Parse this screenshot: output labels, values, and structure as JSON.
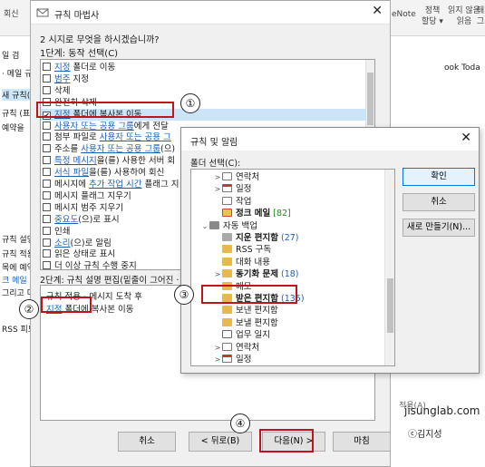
{
  "bg": {
    "ribbon_left": [
      "회신"
    ],
    "ribbon_right": {
      "onenote": "eNote",
      "policy": "정책\n할당 ▾",
      "unread": "읽지 않음\n읽음",
      "tag": "태그"
    },
    "left_panel": [
      "일 검",
      "· 메일 규",
      "새 규칙(",
      "규칙 (표",
      "예약을",
      "규칙 설명(",
      "규칙 적용",
      "목에 예약",
      "크 메일",
      "그리고 다",
      "RSS 피드"
    ],
    "right_panel": "ook Toda",
    "status_text": "적용(A)"
  },
  "wizard": {
    "title": "규칙 마법사",
    "question": "2  시지로 무엇을 하시겠습니까?",
    "step1_label": "1단계: 동작 선택(C)",
    "actions": [
      {
        "checked": false,
        "prefix": "",
        "link": "지정",
        "suffix": " 폴더로 이동"
      },
      {
        "checked": false,
        "prefix": "",
        "link": "범주",
        "suffix": " 지정"
      },
      {
        "checked": false,
        "prefix": "삭제",
        "link": "",
        "suffix": ""
      },
      {
        "checked": false,
        "prefix": "완전히 삭제",
        "link": "",
        "suffix": ""
      },
      {
        "checked": true,
        "prefix": "",
        "link": "지정",
        "suffix": " 폴더에 복사본 이동"
      },
      {
        "checked": false,
        "prefix": "",
        "link": "사용자 또는 공용 그룹",
        "suffix": "에게 전달"
      },
      {
        "checked": false,
        "prefix": "첨부 파일로 ",
        "link": "사용자 또는 공용 그",
        "suffix": ""
      },
      {
        "checked": false,
        "prefix": "주소를 ",
        "link": "사용자 또는 공용 그룹",
        "suffix": "(으)"
      },
      {
        "checked": false,
        "prefix": "",
        "link": "특정 메시지",
        "suffix": "을(를) 사용한 서버 회"
      },
      {
        "checked": false,
        "prefix": "",
        "link": "서식 파일",
        "suffix": "을(를) 사용하여 회신"
      },
      {
        "checked": false,
        "prefix": "메시지에 ",
        "link": "추가 작업 시간",
        "suffix": " 플래그 지"
      },
      {
        "checked": false,
        "prefix": "메시지 플래그 지우기",
        "link": "",
        "suffix": ""
      },
      {
        "checked": false,
        "prefix": "메시지 범주 지우기",
        "link": "",
        "suffix": ""
      },
      {
        "checked": false,
        "prefix": "",
        "link": "중요도",
        "suffix": "(으)로 표시"
      },
      {
        "checked": false,
        "prefix": "인쇄",
        "link": "",
        "suffix": ""
      },
      {
        "checked": false,
        "prefix": "",
        "link": "소리",
        "suffix": "(으)로 알림"
      },
      {
        "checked": false,
        "prefix": "읽은 상태로 표시",
        "link": "",
        "suffix": ""
      },
      {
        "checked": false,
        "prefix": "더 이상 규칙 수행 중지",
        "link": "",
        "suffix": ""
      }
    ],
    "step2_label": "2단계: 규칙 설명 편집(밑줄이 그어진 · 값",
    "desc_line1": "규칙 적용 - 메시지 도착 후",
    "desc_line2_link": "지정",
    "desc_line2_rest": " 폴더에 복사본 이동",
    "buttons": {
      "cancel": "취소",
      "back": "< 뒤로(B)",
      "next": "다음(N) >",
      "finish": "마침"
    }
  },
  "folder_dialog": {
    "title": "규칙 및 알림",
    "label": "폴더 선택(C):",
    "tree": [
      {
        "exp": ">",
        "icon": "contact",
        "name": "연락처",
        "bold": false,
        "count": "",
        "level": 1
      },
      {
        "exp": ">",
        "icon": "calendar",
        "name": "일정",
        "bold": false,
        "count": "",
        "level": 1
      },
      {
        "exp": "",
        "icon": "task",
        "name": "작업",
        "bold": false,
        "count": "",
        "level": 1
      },
      {
        "exp": "",
        "icon": "junk",
        "name": "정크 메일",
        "bold": true,
        "count": "[82]",
        "count_color": "green",
        "level": 1
      },
      {
        "exp": "⌄",
        "icon": "archive",
        "name": "자동 백업",
        "bold": false,
        "count": "",
        "level": 0
      },
      {
        "exp": "",
        "icon": "deleted",
        "name": "지운 편지함",
        "bold": true,
        "count": "(27)",
        "level": 1
      },
      {
        "exp": "",
        "icon": "folder",
        "name": "RSS 구독",
        "bold": false,
        "count": "",
        "level": 1
      },
      {
        "exp": "",
        "icon": "folder",
        "name": "대화 내용",
        "bold": false,
        "count": "",
        "level": 1
      },
      {
        "exp": ">",
        "icon": "folder",
        "name": "동기화 문제",
        "bold": true,
        "count": "(18)",
        "level": 1
      },
      {
        "exp": "",
        "icon": "folder",
        "name": "메모",
        "bold": false,
        "count": "",
        "level": 1
      },
      {
        "exp": "",
        "icon": "inbox",
        "name": "받은 편지함",
        "bold": true,
        "count": "(135)",
        "level": 1
      },
      {
        "exp": "",
        "icon": "sent",
        "name": "보낸 편지함",
        "bold": false,
        "count": "",
        "level": 1
      },
      {
        "exp": "",
        "icon": "sent",
        "name": "보낼 편지함",
        "bold": false,
        "count": "",
        "level": 1
      },
      {
        "exp": "",
        "icon": "journal",
        "name": "업무 일지",
        "bold": false,
        "count": "",
        "level": 1
      },
      {
        "exp": ">",
        "icon": "contact",
        "name": "연락처",
        "bold": false,
        "count": "",
        "level": 1
      },
      {
        "exp": ">",
        "icon": "calendar",
        "name": "일정",
        "bold": false,
        "count": "",
        "level": 1
      }
    ],
    "buttons": {
      "ok": "확인",
      "cancel": "취소",
      "new": "새로 만들기(N)..."
    }
  },
  "annotations": {
    "c1": "①",
    "c2": "②",
    "c3": "③",
    "c4": "④",
    "brand": "jisunglab.com",
    "copyright": "ⓒ김지성"
  },
  "colors": {
    "highlight": "#c0141c",
    "link": "#1a5fb4",
    "selected": "#cce4f7"
  }
}
